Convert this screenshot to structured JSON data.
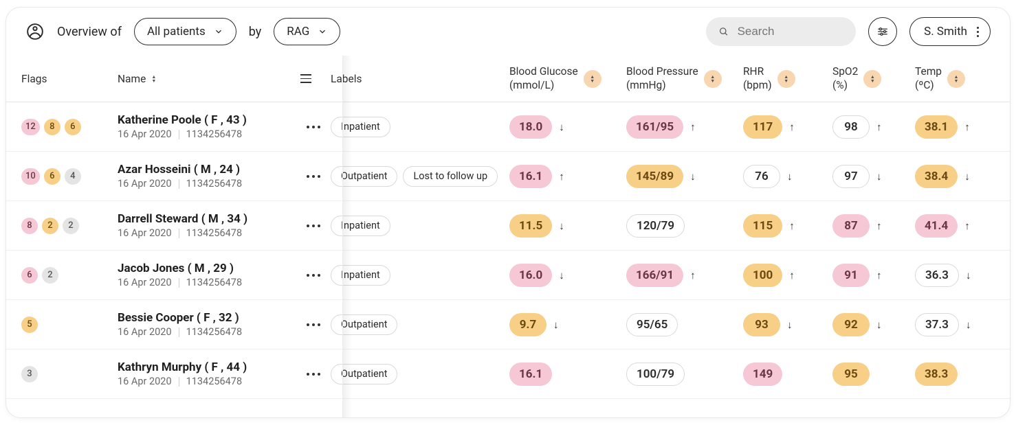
{
  "topbar": {
    "overview_prefix": "Overview of",
    "scope_label": "All patients",
    "by_label": "by",
    "group_label": "RAG",
    "search_placeholder": "Search",
    "user_label": "S. Smith"
  },
  "columns": {
    "flags": "Flags",
    "name": "Name",
    "labels": "Labels",
    "bg_l1": "Blood Glucose",
    "bg_l2": "(mmol/L)",
    "bp_l1": "Blood Pressure",
    "bp_l2": "(mmHg)",
    "rhr_l1": "RHR",
    "rhr_l2": "(bpm)",
    "spo2_l1": "SpO2",
    "spo2_l2": "(%)",
    "temp_l1": "Temp",
    "temp_l2": "(ºC)"
  },
  "patients": [
    {
      "flags": [
        {
          "v": "12",
          "c": "c-pink"
        },
        {
          "v": "8",
          "c": "c-amber"
        },
        {
          "v": "6",
          "c": "c-amber"
        }
      ],
      "name": "Katherine Poole ( F , 43 )",
      "date": "16 Apr 2020",
      "id": "1134256478",
      "labels": [
        "Inpatient"
      ],
      "bg": {
        "v": "18.0",
        "c": "m-pink",
        "arrow": "down"
      },
      "bp": {
        "v": "161/95",
        "c": "m-pink",
        "arrow": "up"
      },
      "rhr": {
        "v": "117",
        "c": "m-amber",
        "arrow": "up"
      },
      "spo2": {
        "v": "98",
        "c": "m-white",
        "arrow": "up"
      },
      "temp": {
        "v": "38.1",
        "c": "m-amber",
        "arrow": "up"
      }
    },
    {
      "flags": [
        {
          "v": "10",
          "c": "c-pink"
        },
        {
          "v": "6",
          "c": "c-amber"
        },
        {
          "v": "4",
          "c": "c-grey"
        }
      ],
      "name": "Azar Hosseini ( M , 24 )",
      "date": "16 Apr 2020",
      "id": "1134256478",
      "labels": [
        "Outpatient",
        "Lost to follow up"
      ],
      "bg": {
        "v": "16.1",
        "c": "m-pink",
        "arrow": "up"
      },
      "bp": {
        "v": "145/89",
        "c": "m-amber",
        "arrow": "down"
      },
      "rhr": {
        "v": "76",
        "c": "m-white",
        "arrow": "down"
      },
      "spo2": {
        "v": "97",
        "c": "m-white",
        "arrow": "down"
      },
      "temp": {
        "v": "38.4",
        "c": "m-amber",
        "arrow": "down"
      }
    },
    {
      "flags": [
        {
          "v": "8",
          "c": "c-pink"
        },
        {
          "v": "2",
          "c": "c-amber"
        },
        {
          "v": "2",
          "c": "c-grey"
        }
      ],
      "name": "Darrell Steward ( M , 34 )",
      "date": "16 Apr 2020",
      "id": "1134256478",
      "labels": [
        "Inpatient"
      ],
      "bg": {
        "v": "11.5",
        "c": "m-amber",
        "arrow": "down"
      },
      "bp": {
        "v": "120/79",
        "c": "m-white",
        "arrow": ""
      },
      "rhr": {
        "v": "115",
        "c": "m-amber",
        "arrow": "up"
      },
      "spo2": {
        "v": "87",
        "c": "m-pink",
        "arrow": "up"
      },
      "temp": {
        "v": "41.4",
        "c": "m-pink",
        "arrow": "up"
      }
    },
    {
      "flags": [
        {
          "v": "6",
          "c": "c-pink"
        },
        {
          "v": "2",
          "c": "c-grey"
        }
      ],
      "name": "Jacob Jones ( M , 29 )",
      "date": "16 Apr 2020",
      "id": "1134256478",
      "labels": [
        "Inpatient"
      ],
      "bg": {
        "v": "16.0",
        "c": "m-pink",
        "arrow": "down"
      },
      "bp": {
        "v": "166/91",
        "c": "m-pink",
        "arrow": "up"
      },
      "rhr": {
        "v": "100",
        "c": "m-amber",
        "arrow": "up"
      },
      "spo2": {
        "v": "91",
        "c": "m-pink",
        "arrow": "up"
      },
      "temp": {
        "v": "36.3",
        "c": "m-white",
        "arrow": "down"
      }
    },
    {
      "flags": [
        {
          "v": "5",
          "c": "c-amber"
        }
      ],
      "name": "Bessie Cooper ( F , 32 )",
      "date": "16 Apr 2020",
      "id": "1134256478",
      "labels": [
        "Outpatient"
      ],
      "bg": {
        "v": "9.7",
        "c": "m-amber",
        "arrow": "down"
      },
      "bp": {
        "v": "95/65",
        "c": "m-white",
        "arrow": ""
      },
      "rhr": {
        "v": "93",
        "c": "m-amber",
        "arrow": "down"
      },
      "spo2": {
        "v": "92",
        "c": "m-amber",
        "arrow": "down"
      },
      "temp": {
        "v": "37.3",
        "c": "m-white",
        "arrow": "down"
      }
    },
    {
      "flags": [
        {
          "v": "3",
          "c": "c-grey"
        }
      ],
      "name": "Kathryn Murphy ( F , 44 )",
      "date": "16 Apr 2020",
      "id": "1134256478",
      "labels": [
        "Outpatient"
      ],
      "bg": {
        "v": "16.1",
        "c": "m-pink",
        "arrow": ""
      },
      "bp": {
        "v": "100/79",
        "c": "m-white",
        "arrow": ""
      },
      "rhr": {
        "v": "149",
        "c": "m-pink",
        "arrow": ""
      },
      "spo2": {
        "v": "95",
        "c": "m-amber",
        "arrow": ""
      },
      "temp": {
        "v": "38.3",
        "c": "m-amber",
        "arrow": ""
      }
    }
  ]
}
